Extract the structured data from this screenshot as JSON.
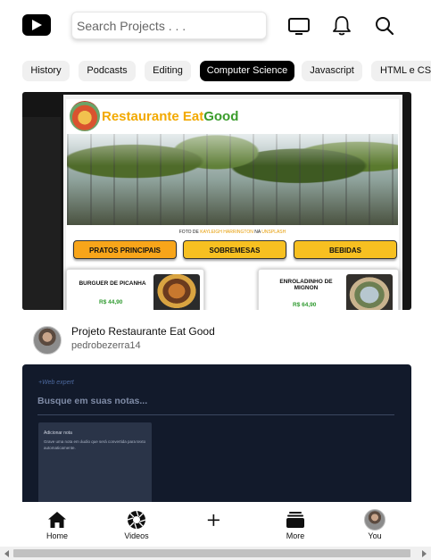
{
  "header": {
    "logo_icon": "youtube-play-icon",
    "search_placeholder": "Search Projects . . .",
    "icons": [
      "tv-icon",
      "bell-icon",
      "search-icon"
    ]
  },
  "chips": [
    {
      "label": "History",
      "active": false
    },
    {
      "label": "Podcasts",
      "active": false
    },
    {
      "label": "Editing",
      "active": false
    },
    {
      "label": "Computer Science",
      "active": true
    },
    {
      "label": "Javascript",
      "active": false
    },
    {
      "label": "HTML e CSS",
      "active": false
    }
  ],
  "video1": {
    "thumbnail": {
      "site_title_part1": "Restaurante Eat",
      "site_title_part2": "Good",
      "credit_prefix": "FOTO DE",
      "credit_author": "KAYLEIGH HARRINGTON",
      "credit_mid": "NA",
      "credit_site": "UNSPLASH",
      "buttons": [
        "PRATOS PRINCIPAIS",
        "SOBREMESAS",
        "BEBIDAS"
      ],
      "cards": [
        {
          "name": "BURGUER DE PICANHA",
          "price": "R$ 44,90"
        },
        {
          "name": "ENROLADINHO DE MIGNON",
          "price": "R$ 64,90"
        }
      ]
    },
    "title": "Projeto Restaurante Eat Good",
    "channel": "pedrobezerra14"
  },
  "video2": {
    "brand": "+Web expert",
    "search_placeholder": "Busque em suas notas...",
    "card_title": "Adicionar nota",
    "card_text": "Grave uma nota em áudio que será convertida para texto automaticamente."
  },
  "bottom_nav": [
    {
      "label": "Home",
      "icon": "home-icon"
    },
    {
      "label": "Videos",
      "icon": "aperture-icon"
    },
    {
      "label": "",
      "icon": "plus-icon"
    },
    {
      "label": "More",
      "icon": "stack-icon"
    },
    {
      "label": "You",
      "icon": "avatar"
    }
  ],
  "colors": {
    "accent": "#000000",
    "chip_bg": "#f0f0f0",
    "site_orange": "#f2a900",
    "site_green": "#3a9c2b",
    "note_bg": "#121a2b"
  }
}
